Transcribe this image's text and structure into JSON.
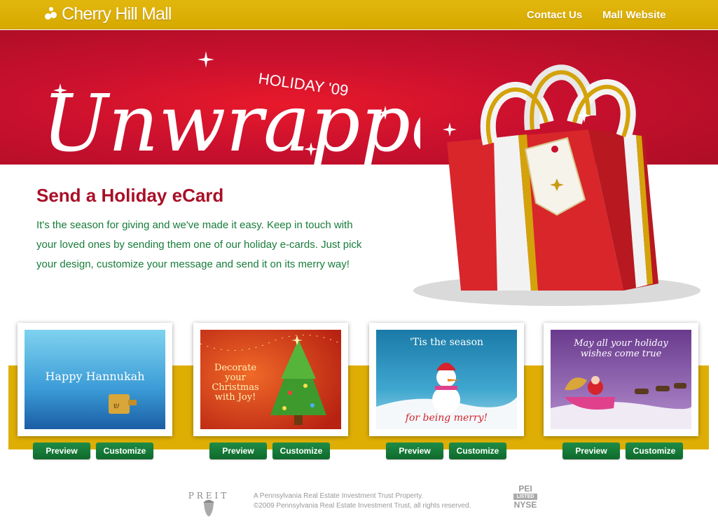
{
  "header": {
    "logo_text": "Cherry Hill Mall",
    "nav": {
      "contact": "Contact Us",
      "mall_website": "Mall Website"
    }
  },
  "hero": {
    "script_title": "Unwrapped",
    "subtitle": "HOLIDAY '09",
    "colors": {
      "red": "#c8102e",
      "gold": "#deae05"
    }
  },
  "intro": {
    "heading": "Send a Holiday eCard",
    "body": "It's the season for giving and we've made it easy. Keep in touch with your loved ones by sending them one of our holiday e-cards. Just pick your design, customize your message and send it on its merry way!"
  },
  "cards": [
    {
      "title": "Happy Hannukah",
      "preview": "Preview",
      "customize": "Customize"
    },
    {
      "title_lines": [
        "Decorate your",
        "Christmas",
        "with Joy!"
      ],
      "preview": "Preview",
      "customize": "Customize"
    },
    {
      "title_top": "'Tis the season",
      "title_bottom": "for being merry!",
      "preview": "Preview",
      "customize": "Customize"
    },
    {
      "title_lines": [
        "May all your holiday",
        "wishes come true"
      ],
      "preview": "Preview",
      "customize": "Customize"
    }
  ],
  "footer": {
    "preit_logo": "PREIT",
    "line1": "A Pennsylvania Real Estate Investment Trust Property.",
    "line2": "©2009 Pennsylvania Real Estate Investment Trust, all rights reserved.",
    "nyse_top": "PEI",
    "nyse_mid": "LISTED",
    "nyse_bottom": "NYSE"
  }
}
